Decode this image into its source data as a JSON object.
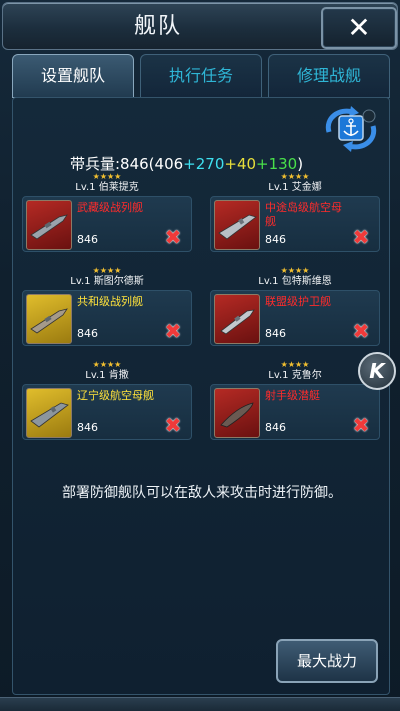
{
  "header": {
    "title": "舰队",
    "close_label": "✕"
  },
  "tabs": [
    {
      "label": "设置舰队",
      "active": true
    },
    {
      "label": "执行任务",
      "active": false
    },
    {
      "label": "修理战舰",
      "active": false
    }
  ],
  "troops": {
    "prefix": "带兵量:846(406",
    "bonus1": "+270",
    "bonus2": "+40",
    "bonus3": "+130",
    "suffix": ")"
  },
  "slots": [
    {
      "stars": "★★★★",
      "level": "Lv.1 伯莱提克",
      "ship": "武藏级战列舰",
      "power": "846",
      "thumb_color": "red",
      "name_color": "red"
    },
    {
      "stars": "★★★★",
      "level": "Lv.1 艾金娜",
      "ship": "中途岛级航空母舰",
      "power": "846",
      "thumb_color": "red",
      "name_color": "red"
    },
    {
      "stars": "★★★★",
      "level": "Lv.1 斯图尔德斯",
      "ship": "共和级战列舰",
      "power": "846",
      "thumb_color": "yellow",
      "name_color": "yellow"
    },
    {
      "stars": "★★★★",
      "level": "Lv.1 包特斯维恩",
      "ship": "联盟级护卫舰",
      "power": "846",
      "thumb_color": "red",
      "name_color": "red"
    },
    {
      "stars": "★★★★",
      "level": "Lv.1 肯撒",
      "ship": "辽宁级航空母舰",
      "power": "846",
      "thumb_color": "yellow",
      "name_color": "yellow"
    },
    {
      "stars": "★★★★",
      "level": "Lv.1 克鲁尔",
      "ship": "射手级潜艇",
      "power": "846",
      "thumb_color": "red",
      "name_color": "red"
    }
  ],
  "remove_label": "✖",
  "k_label": "K",
  "hint": "部署防御舰队可以在敌人来攻击时进行防御。",
  "max_power_label": "最大战力",
  "icons": {
    "close": "close-icon",
    "swap": "anchor-swap-icon",
    "remove": "remove-icon",
    "k": "k-float-icon"
  },
  "colors": {
    "bonus1": "#3ee0f0",
    "bonus2": "#e8df3a",
    "bonus3": "#49e04a",
    "ship_red": "#ff2b2b",
    "ship_yellow": "#ffe23b",
    "tab_inactive": "#2fb6d6"
  }
}
